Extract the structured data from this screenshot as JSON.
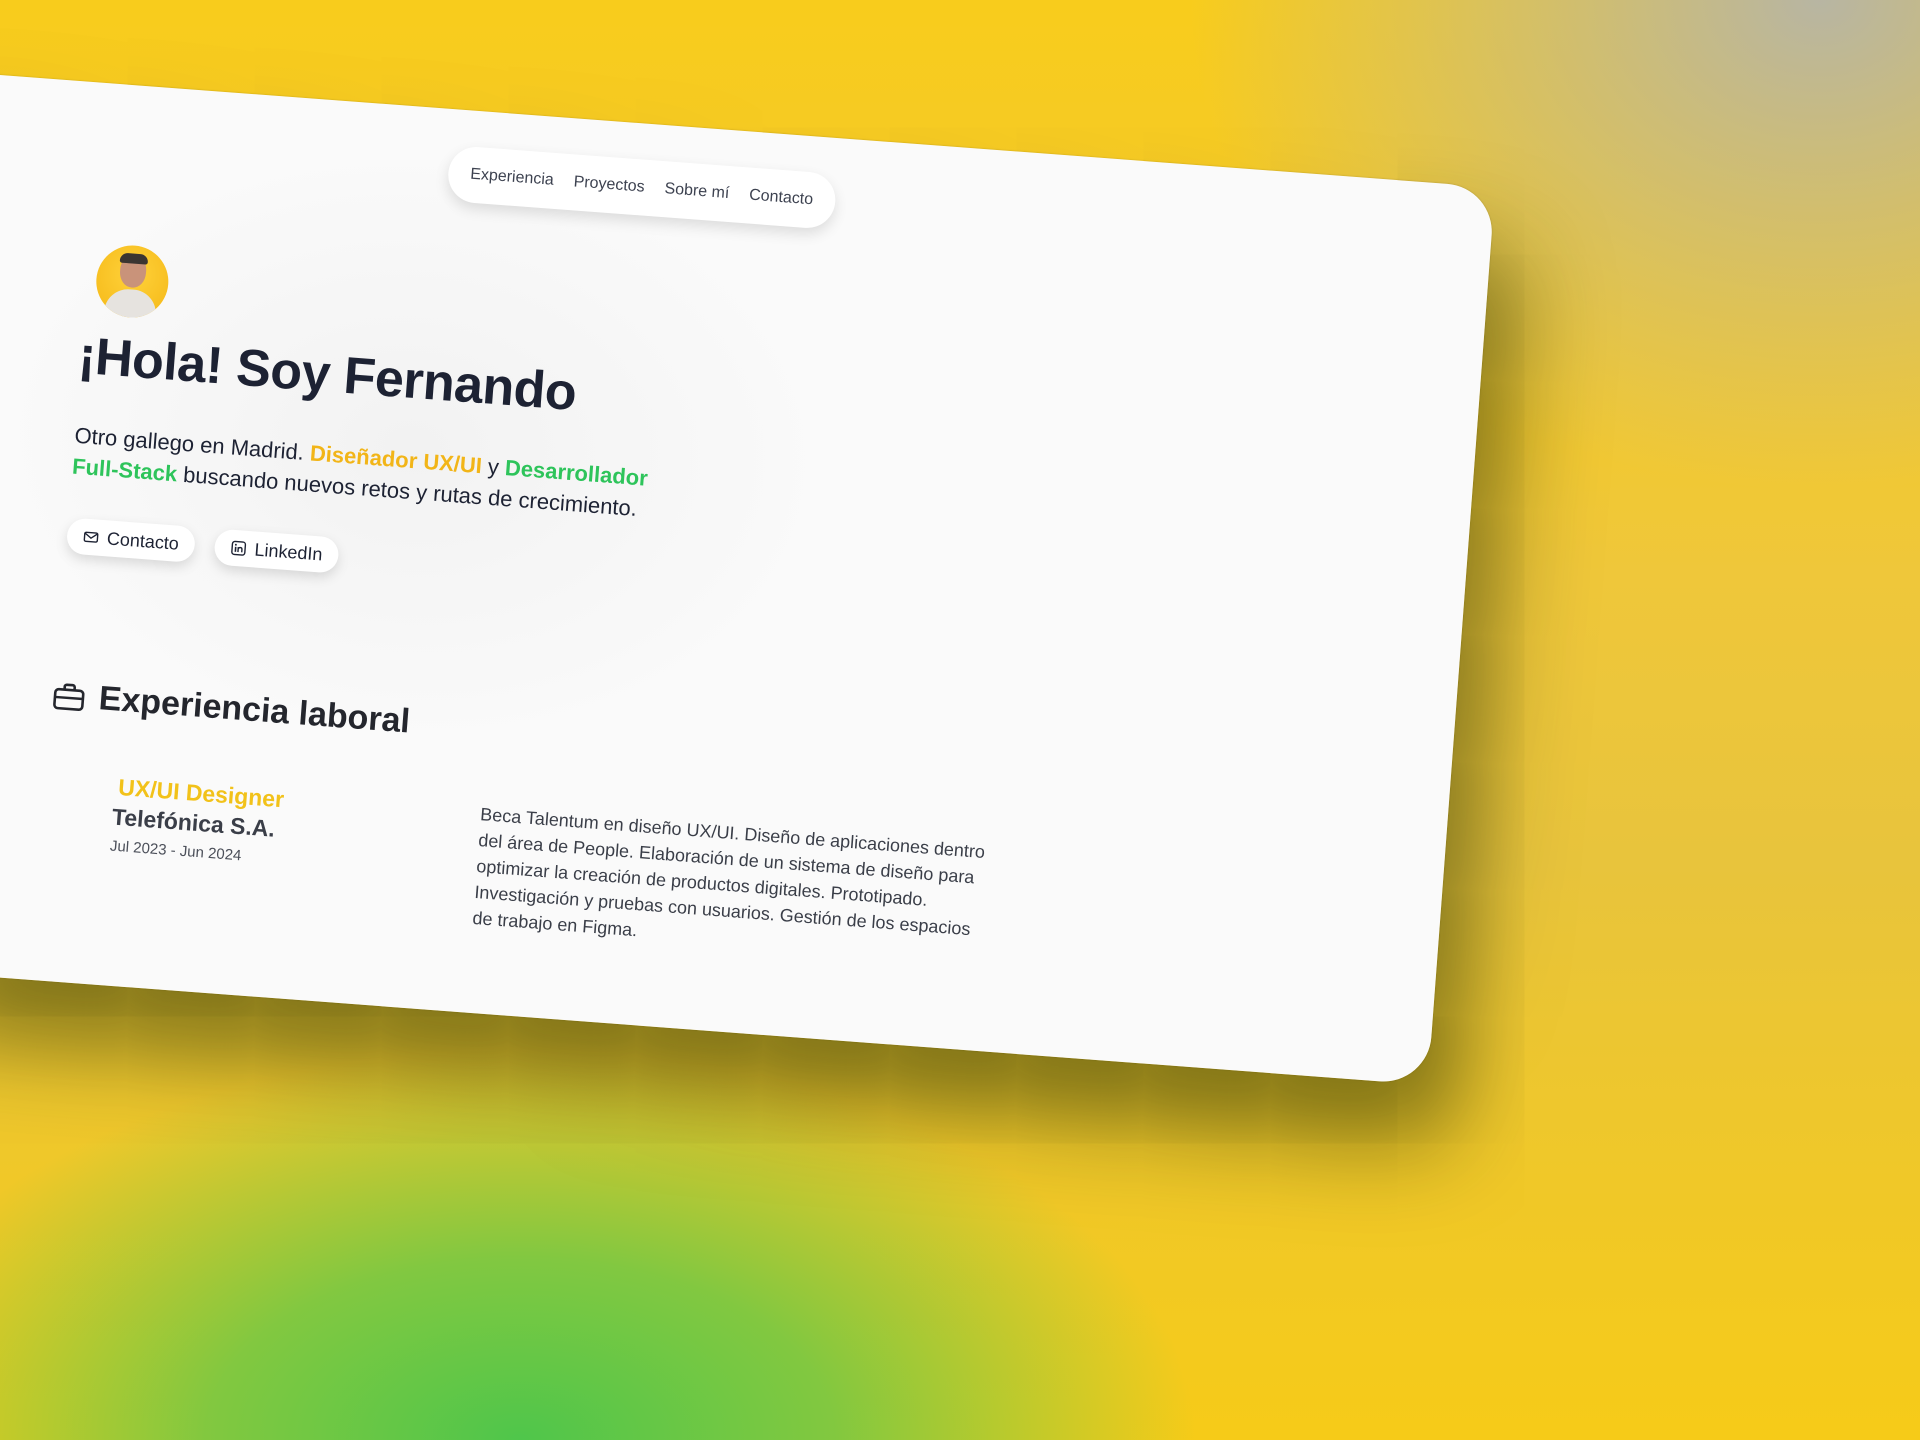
{
  "nav": {
    "items": [
      "Experiencia",
      "Proyectos",
      "Sobre mí",
      "Contacto"
    ]
  },
  "hero": {
    "title": "¡Hola! Soy Fernando",
    "subtitle_part1": "Otro gallego en Madrid. ",
    "subtitle_hl1": "Diseñador UX/UI",
    "subtitle_part2": " y ",
    "subtitle_hl2": "Desarrollador Full-Stack",
    "subtitle_part3": " buscando nuevos retos y rutas de crecimiento.",
    "buttons": {
      "contact_label": "Contacto",
      "linkedin_label": "LinkedIn"
    }
  },
  "experience": {
    "title": "Experiencia laboral",
    "jobs": [
      {
        "role": "UX/UI Designer",
        "company": "Telefónica S.A.",
        "dates": "Jul 2023 - Jun 2024",
        "description": "Beca Talentum en diseño UX/UI. Diseño de aplicaciones dentro del área de People. Elaboración de un sistema de diseño para optimizar la creación de productos digitales. Prototipado. Investigación y pruebas con usuarios. Gestión de los espacios de trabajo en Figma."
      }
    ]
  },
  "colors": {
    "accent_yellow": "#f2b518",
    "accent_green": "#2ec45b",
    "text_dark": "#1d2233"
  },
  "icons": {
    "contact_button": "mail-icon",
    "linkedin_button": "linkedin-icon",
    "experience_heading": "briefcase-icon"
  }
}
